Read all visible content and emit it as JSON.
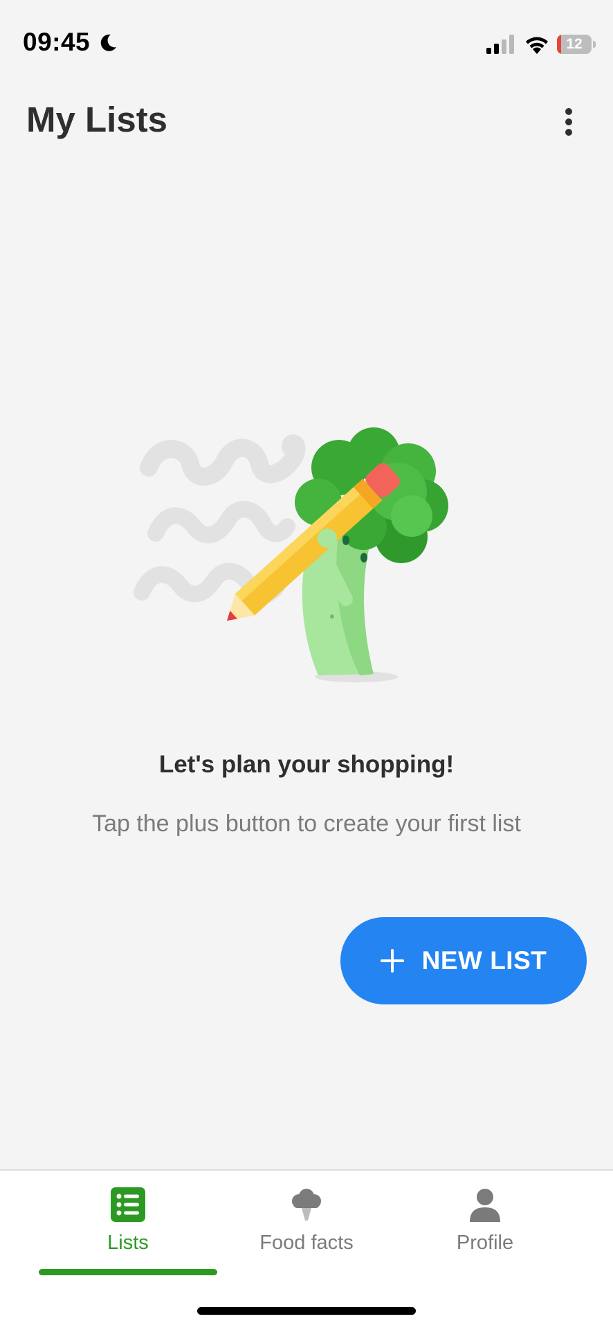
{
  "status_bar": {
    "time": "09:45",
    "battery_level": "12",
    "battery_fraction": 0.12,
    "icons": [
      "moon-icon",
      "signal-icon",
      "wifi-icon",
      "battery-icon"
    ]
  },
  "header": {
    "title": "My Lists",
    "menu_icon": "more-vertical-icon"
  },
  "empty_state": {
    "illustration": "broccoli-with-pencil-illustration",
    "title": "Let's plan your shopping!",
    "subtitle": "Tap the plus button to create your first list"
  },
  "new_list_button": {
    "icon": "plus-icon",
    "label": "NEW LIST",
    "color": "#2384f2"
  },
  "bottom_nav": {
    "active_color": "#2c9a22",
    "items": [
      {
        "label": "Lists",
        "icon": "list-icon",
        "active": true
      },
      {
        "label": "Food facts",
        "icon": "broccoli-icon",
        "active": false
      },
      {
        "label": "Profile",
        "icon": "profile-icon",
        "active": false
      }
    ]
  }
}
